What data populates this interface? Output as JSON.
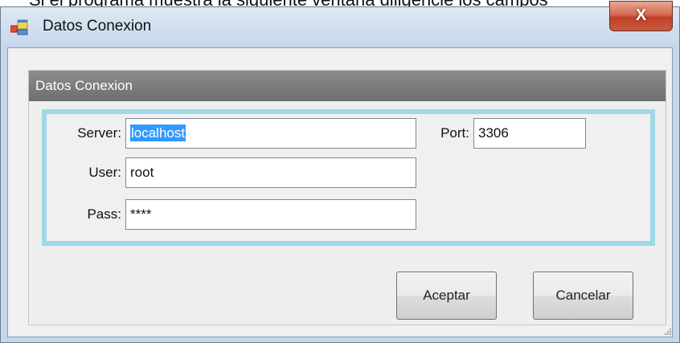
{
  "background_text": "Si el programa muestra la siguiente ventana diligencie los campos",
  "window": {
    "title": "Datos Conexion",
    "close_label": "X",
    "icon": "windows-form-icon"
  },
  "group": {
    "header": "Datos Conexion"
  },
  "form": {
    "server_label": "Server:",
    "server_value": "localhost",
    "port_label": "Port:",
    "port_value": "3306",
    "user_label": "User:",
    "user_value": "root",
    "pass_label": "Pass:",
    "pass_value": "****"
  },
  "buttons": {
    "accept": "Aceptar",
    "cancel": "Cancelar"
  },
  "colors": {
    "frame_border": "#9fd8e8",
    "selection": "#3399ff",
    "header_bg": "#7d7d7d",
    "close_button": "#c95a3e"
  }
}
